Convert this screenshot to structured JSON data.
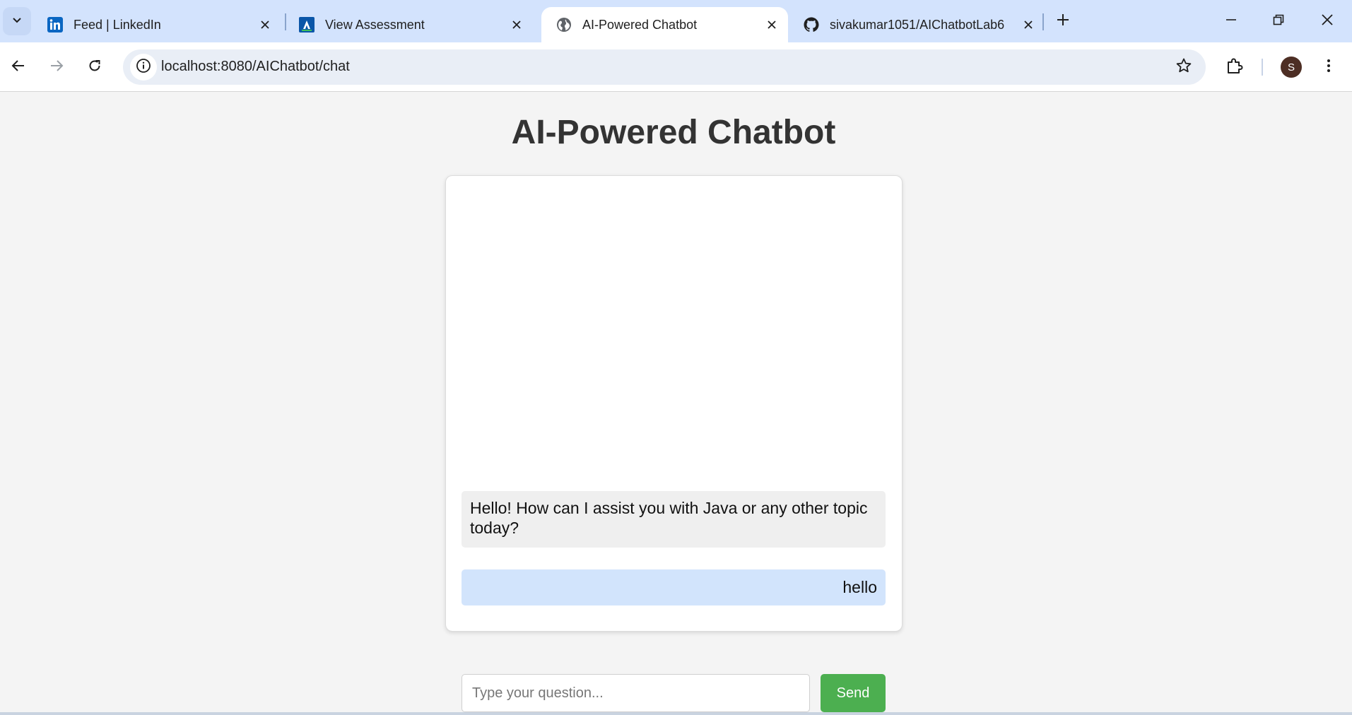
{
  "browser": {
    "tabs": [
      {
        "title": "Feed | LinkedIn",
        "favicon": "linkedin-icon",
        "active": false
      },
      {
        "title": "View Assessment",
        "favicon": "assessment-icon",
        "active": false
      },
      {
        "title": "AI-Powered Chatbot",
        "favicon": "globe-icon",
        "active": true
      },
      {
        "title": "sivakumar1051/AIChatbotLab6",
        "favicon": "github-icon",
        "active": false
      }
    ],
    "url": "localhost:8080/AIChatbot/chat",
    "profile_initial": "S",
    "accent_color": "#d3e3fd"
  },
  "page": {
    "title": "AI-Powered Chatbot",
    "messages": [
      {
        "sender": "bot",
        "text": "Hello! How can I assist you with Java or any other topic today?"
      },
      {
        "sender": "user",
        "text": "hello"
      }
    ],
    "input": {
      "placeholder": "Type your question...",
      "value": ""
    },
    "send_label": "Send",
    "send_color": "#4caf50",
    "user_bubble_color": "#d2e4fc",
    "bot_bubble_color": "#efefef"
  }
}
